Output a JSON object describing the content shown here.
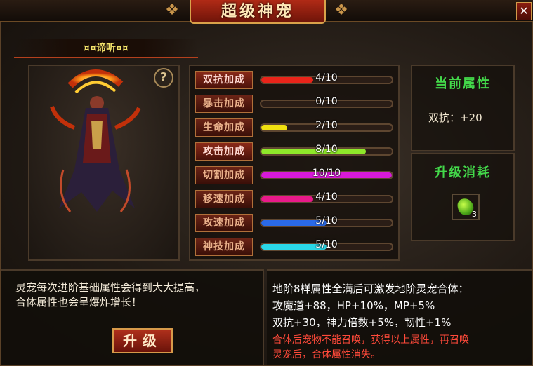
{
  "window": {
    "title": "超级神宠",
    "close_label": "✕"
  },
  "pet": {
    "name": "¤¤谛听¤¤",
    "help_label": "?"
  },
  "stats": [
    {
      "label": "双抗加成",
      "current": 4,
      "max": 10,
      "text": "4/10",
      "color": "#e8241a",
      "active": true
    },
    {
      "label": "暴击加成",
      "current": 0,
      "max": 10,
      "text": "0/10",
      "color": "#e8241a",
      "active": false
    },
    {
      "label": "生命加成",
      "current": 2,
      "max": 10,
      "text": "2/10",
      "color": "#f0e010",
      "active": false
    },
    {
      "label": "攻击加成",
      "current": 8,
      "max": 10,
      "text": "8/10",
      "color": "#8ee82a",
      "active": true
    },
    {
      "label": "切割加成",
      "current": 10,
      "max": 10,
      "text": "10/10",
      "color": "#d81ad8",
      "active": false
    },
    {
      "label": "移速加成",
      "current": 4,
      "max": 10,
      "text": "4/10",
      "color": "#e81a8a",
      "active": false
    },
    {
      "label": "攻速加成",
      "current": 5,
      "max": 10,
      "text": "5/10",
      "color": "#2a6ae8",
      "active": false
    },
    {
      "label": "神技加成",
      "current": 5,
      "max": 10,
      "text": "5/10",
      "color": "#2ad8e8",
      "active": false
    }
  ],
  "current_attributes": {
    "title": "当前属性",
    "line": "双抗：+20"
  },
  "upgrade_cost": {
    "title": "升级消耗",
    "item_icon": "green-gem-icon",
    "item_count": "3"
  },
  "description_left": {
    "line1": "灵宠每次进阶基础属性会得到大大提高，",
    "line2": "合体属性也会呈爆炸增长！"
  },
  "upgrade_button_label": "升级",
  "description_right": {
    "line1": "地阶8样属性全满后可激发地阶灵宠合体：",
    "line2": "攻魔道+88，HP+10%，MP+5%",
    "line3": "双抗+30，神力倍数+5%，韧性+1%",
    "warn1": "合体后宠物不能召唤，获得以上属性，再召唤",
    "warn2": "灵宠后，合体属性消失。"
  }
}
